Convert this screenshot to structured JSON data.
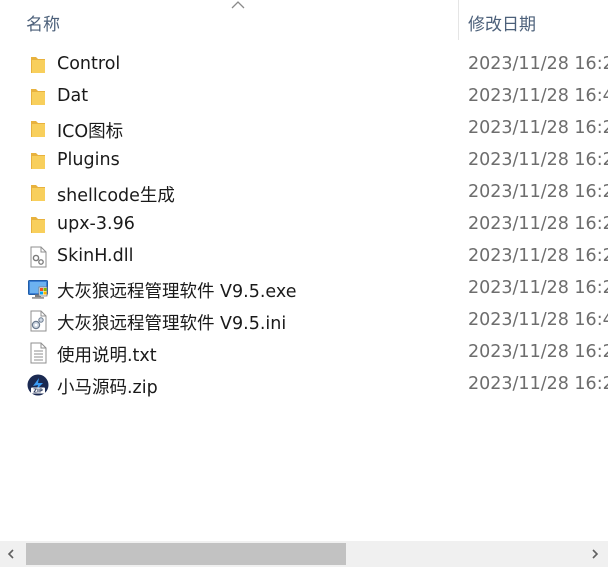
{
  "header": {
    "name_label": "名称",
    "date_label": "修改日期",
    "sort": "ascending"
  },
  "files": [
    {
      "name": "Control",
      "date": "2023/11/28 16:2",
      "icon": "folder-icon"
    },
    {
      "name": "Dat",
      "date": "2023/11/28 16:4",
      "icon": "folder-icon"
    },
    {
      "name": "ICO图标",
      "date": "2023/11/28 16:2",
      "icon": "folder-icon"
    },
    {
      "name": "Plugins",
      "date": "2023/11/28 16:2",
      "icon": "folder-icon"
    },
    {
      "name": "shellcode生成",
      "date": "2023/11/28 16:2",
      "icon": "folder-icon"
    },
    {
      "name": "upx-3.96",
      "date": "2023/11/28 16:2",
      "icon": "folder-icon"
    },
    {
      "name": "SkinH.dll",
      "date": "2023/11/28 16:2",
      "icon": "dll-file-icon"
    },
    {
      "name": "大灰狼远程管理软件 V9.5.exe",
      "date": "2023/11/28 16:2",
      "icon": "exe-file-icon"
    },
    {
      "name": "大灰狼远程管理软件 V9.5.ini",
      "date": "2023/11/28 16:4",
      "icon": "ini-file-icon"
    },
    {
      "name": "使用说明.txt",
      "date": "2023/11/28 16:2",
      "icon": "text-file-icon"
    },
    {
      "name": "小马源码.zip",
      "date": "2023/11/28 16:2",
      "icon": "zip-file-icon"
    }
  ],
  "colors": {
    "folder": "#f8cf5c",
    "header_text": "#4c607a",
    "date_text": "#6d6d6d",
    "scrollbar_thumb": "#c2c2c2",
    "scrollbar_track": "#f0f0f0"
  }
}
